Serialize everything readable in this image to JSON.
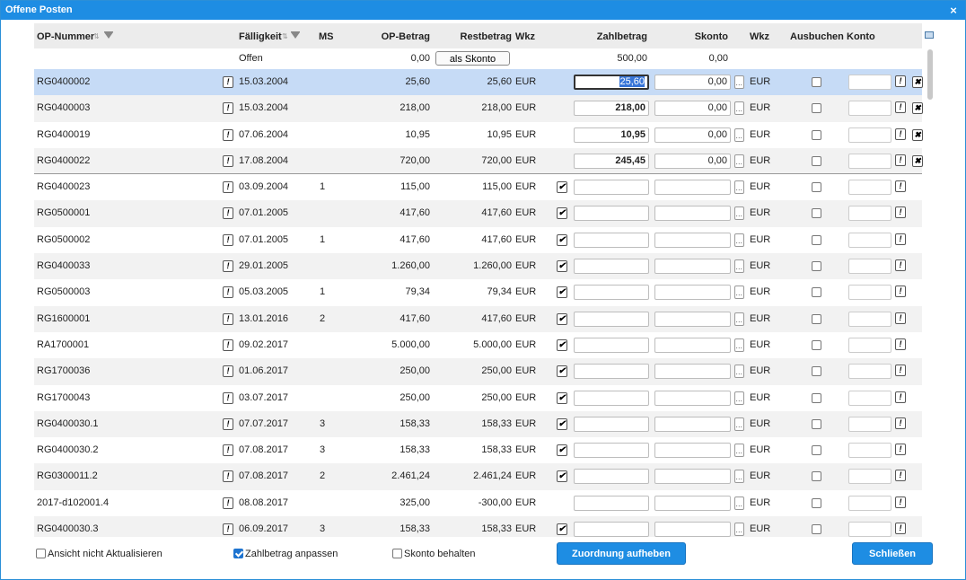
{
  "window": {
    "title": "Offene Posten",
    "close": "×"
  },
  "header": {
    "op_nummer": "OP-Nummer",
    "faelligkeit": "Fälligkeit",
    "ms": "MS",
    "op_betrag": "OP-Betrag",
    "restbetrag": "Restbetrag",
    "wkz": "Wkz",
    "zahlbetrag": "Zahlbetrag",
    "skonto": "Skonto",
    "wkz2": "Wkz",
    "ausbuchen": "Ausbuchen",
    "konto": "Konto"
  },
  "summary": {
    "label": "Offen",
    "op_betrag": "0,00",
    "als_skonto": "als Skonto",
    "zahlbetrag": "500,00",
    "skonto": "0,00"
  },
  "rows": [
    {
      "nr": "RG0400002",
      "date": "15.03.2004",
      "ms": "",
      "op": "25,60",
      "rest": "25,60",
      "wkz": "EUR",
      "checked": false,
      "zahl": "25,60",
      "skonto": "0,00",
      "wkz2": "EUR",
      "assigned": true,
      "selected": true
    },
    {
      "nr": "RG0400003",
      "date": "15.03.2004",
      "ms": "",
      "op": "218,00",
      "rest": "218,00",
      "wkz": "EUR",
      "checked": false,
      "zahl": "218,00",
      "skonto": "0,00",
      "wkz2": "EUR",
      "assigned": true
    },
    {
      "nr": "RG0400019",
      "date": "07.06.2004",
      "ms": "",
      "op": "10,95",
      "rest": "10,95",
      "wkz": "EUR",
      "checked": false,
      "zahl": "10,95",
      "skonto": "0,00",
      "wkz2": "EUR",
      "assigned": true
    },
    {
      "nr": "RG0400022",
      "date": "17.08.2004",
      "ms": "",
      "op": "720,00",
      "rest": "720,00",
      "wkz": "EUR",
      "checked": false,
      "zahl": "245,45",
      "skonto": "0,00",
      "wkz2": "EUR",
      "assigned": true
    },
    {
      "nr": "RG0400023",
      "date": "03.09.2004",
      "ms": "1",
      "op": "115,00",
      "rest": "115,00",
      "wkz": "EUR",
      "checked": true,
      "zahl": "",
      "skonto": "",
      "wkz2": "EUR"
    },
    {
      "nr": "RG0500001",
      "date": "07.01.2005",
      "ms": "",
      "op": "417,60",
      "rest": "417,60",
      "wkz": "EUR",
      "checked": true,
      "zahl": "",
      "skonto": "",
      "wkz2": "EUR"
    },
    {
      "nr": "RG0500002",
      "date": "07.01.2005",
      "ms": "1",
      "op": "417,60",
      "rest": "417,60",
      "wkz": "EUR",
      "checked": true,
      "zahl": "",
      "skonto": "",
      "wkz2": "EUR"
    },
    {
      "nr": "RG0400033",
      "date": "29.01.2005",
      "ms": "",
      "op": "1.260,00",
      "rest": "1.260,00",
      "wkz": "EUR",
      "checked": true,
      "zahl": "",
      "skonto": "",
      "wkz2": "EUR"
    },
    {
      "nr": "RG0500003",
      "date": "05.03.2005",
      "ms": "1",
      "op": "79,34",
      "rest": "79,34",
      "wkz": "EUR",
      "checked": true,
      "zahl": "",
      "skonto": "",
      "wkz2": "EUR"
    },
    {
      "nr": "RG1600001",
      "date": "13.01.2016",
      "ms": "2",
      "op": "417,60",
      "rest": "417,60",
      "wkz": "EUR",
      "checked": true,
      "zahl": "",
      "skonto": "",
      "wkz2": "EUR"
    },
    {
      "nr": "RA1700001",
      "date": "09.02.2017",
      "ms": "",
      "op": "5.000,00",
      "rest": "5.000,00",
      "wkz": "EUR",
      "checked": true,
      "zahl": "",
      "skonto": "",
      "wkz2": "EUR"
    },
    {
      "nr": "RG1700036",
      "date": "01.06.2017",
      "ms": "",
      "op": "250,00",
      "rest": "250,00",
      "wkz": "EUR",
      "checked": true,
      "zahl": "",
      "skonto": "",
      "wkz2": "EUR"
    },
    {
      "nr": "RG1700043",
      "date": "03.07.2017",
      "ms": "",
      "op": "250,00",
      "rest": "250,00",
      "wkz": "EUR",
      "checked": true,
      "zahl": "",
      "skonto": "",
      "wkz2": "EUR"
    },
    {
      "nr": "RG0400030.1",
      "date": "07.07.2017",
      "ms": "3",
      "op": "158,33",
      "rest": "158,33",
      "wkz": "EUR",
      "checked": true,
      "zahl": "",
      "skonto": "",
      "wkz2": "EUR"
    },
    {
      "nr": "RG0400030.2",
      "date": "07.08.2017",
      "ms": "3",
      "op": "158,33",
      "rest": "158,33",
      "wkz": "EUR",
      "checked": true,
      "zahl": "",
      "skonto": "",
      "wkz2": "EUR"
    },
    {
      "nr": "RG0300011.2",
      "date": "07.08.2017",
      "ms": "2",
      "op": "2.461,24",
      "rest": "2.461,24",
      "wkz": "EUR",
      "checked": true,
      "zahl": "",
      "skonto": "",
      "wkz2": "EUR"
    },
    {
      "nr": "2017-d102001.4",
      "date": "08.08.2017",
      "ms": "",
      "op": "325,00",
      "rest": "-300,00",
      "wkz": "EUR",
      "checked": false,
      "zahl": "",
      "skonto": "",
      "wkz2": "EUR"
    },
    {
      "nr": "RG0400030.3",
      "date": "06.09.2017",
      "ms": "3",
      "op": "158,33",
      "rest": "158,33",
      "wkz": "EUR",
      "checked": true,
      "zahl": "",
      "skonto": "",
      "wkz2": "EUR"
    }
  ],
  "footer": {
    "ansicht": "Ansicht nicht Aktualisieren",
    "zahlbetrag_anpassen": "Zahlbetrag anpassen",
    "skonto_behalten": "Skonto behalten",
    "zuordnung": "Zuordnung aufheben",
    "schliessen": "Schließen"
  },
  "colors": {
    "accent": "#1e8de3",
    "selected_row": "#c6dbf6",
    "alt_row": "#f2f2f2"
  }
}
